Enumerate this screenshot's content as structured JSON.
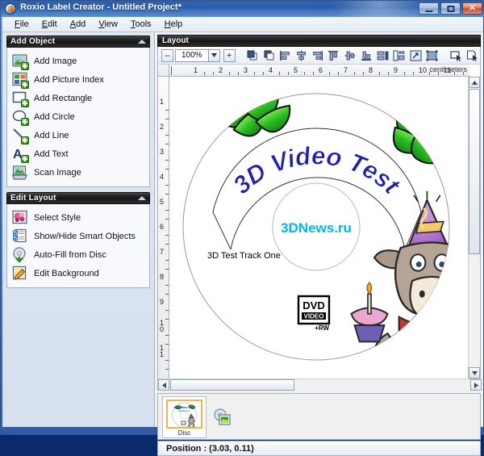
{
  "window": {
    "title": "Roxio Label Creator - Untitled Project*",
    "app_icon": "roxio-disc-icon",
    "minimize_label": "–",
    "maximize_label": "",
    "close_label": "✕"
  },
  "menubar": {
    "items": [
      {
        "name": "file",
        "label": "File",
        "mnemonic": "F"
      },
      {
        "name": "edit",
        "label": "Edit",
        "mnemonic": "E"
      },
      {
        "name": "add",
        "label": "Add",
        "mnemonic": "A"
      },
      {
        "name": "view",
        "label": "View",
        "mnemonic": "V"
      },
      {
        "name": "tools",
        "label": "Tools",
        "mnemonic": "T"
      },
      {
        "name": "help",
        "label": "Help",
        "mnemonic": "H"
      }
    ]
  },
  "left_panel": {
    "groups": [
      {
        "title": "Add Object",
        "collapse_icon": "chevron-up-icon",
        "items": [
          {
            "label": "Add Image",
            "icon": "image-add-icon"
          },
          {
            "label": "Add Picture Index",
            "icon": "picture-index-add-icon"
          },
          {
            "label": "Add Rectangle",
            "icon": "rectangle-add-icon"
          },
          {
            "label": "Add Circle",
            "icon": "circle-add-icon"
          },
          {
            "label": "Add Line",
            "icon": "line-add-icon"
          },
          {
            "label": "Add Text",
            "icon": "text-add-icon"
          },
          {
            "label": "Scan Image",
            "icon": "scanner-icon"
          }
        ]
      },
      {
        "title": "Edit Layout",
        "collapse_icon": "chevron-up-icon",
        "items": [
          {
            "label": "Select Style",
            "icon": "style-palette-icon"
          },
          {
            "label": "Show/Hide Smart Objects",
            "icon": "smart-objects-icon"
          },
          {
            "label": "Auto-Fill from Disc",
            "icon": "autofill-disc-icon"
          },
          {
            "label": "Edit Background",
            "icon": "edit-background-icon"
          }
        ]
      }
    ]
  },
  "layout_pane": {
    "header_title": "Layout",
    "toolbar": {
      "zoom_out_label": "–",
      "zoom_value": "100%",
      "zoom_dropdown_icon": "chevron-down-icon",
      "zoom_in_label": "+",
      "buttons": [
        {
          "name": "bring-to-front",
          "tooltip": "Bring to Front",
          "icon": "bring-to-front-icon"
        },
        {
          "name": "send-to-back",
          "tooltip": "Send to Back",
          "icon": "send-to-back-icon"
        },
        {
          "name": "align-left",
          "tooltip": "Align Left",
          "icon": "align-left-icon"
        },
        {
          "name": "align-center-horizontal",
          "tooltip": "Align Center",
          "icon": "align-center-icon"
        },
        {
          "name": "align-right",
          "tooltip": "Align Right",
          "icon": "align-right-icon"
        },
        {
          "name": "align-top",
          "tooltip": "Align Top",
          "icon": "align-top-icon"
        },
        {
          "name": "align-middle",
          "tooltip": "Align Middle",
          "icon": "align-middle-icon"
        },
        {
          "name": "align-bottom",
          "tooltip": "Align Bottom",
          "icon": "align-bottom-icon"
        },
        {
          "name": "distribute-horizontal",
          "tooltip": "Distribute Horizontally",
          "icon": "distribute-horizontal-icon"
        },
        {
          "name": "distribute-vertical",
          "tooltip": "Distribute Vertically",
          "icon": "distribute-vertical-icon"
        },
        {
          "name": "resize-object",
          "tooltip": "Resize",
          "icon": "resize-icon"
        },
        {
          "name": "group-objects",
          "tooltip": "Group",
          "icon": "group-objects-icon"
        },
        {
          "name": "select-object",
          "tooltip": "Select Object",
          "icon": "select-object-icon"
        },
        {
          "name": "select-page",
          "tooltip": "Select Page",
          "icon": "select-page-icon"
        }
      ]
    },
    "ruler": {
      "unit_label": "centimeters",
      "h_ticks": [
        "1",
        "2",
        "3",
        "4",
        "5",
        "6",
        "7",
        "8",
        "9",
        "10",
        "11"
      ],
      "v_ticks": [
        "1",
        "2",
        "3",
        "4",
        "5",
        "6",
        "7",
        "8",
        "9",
        "10",
        "11"
      ]
    },
    "scrollbars": {
      "up_arrow": "▲",
      "down_arrow": "▼",
      "left_arrow": "◀",
      "right_arrow": "▶"
    }
  },
  "disc_label": {
    "title_text": "3D Video Test",
    "title_color": "#2020b0",
    "subtitle_text": "3DNews.ru",
    "subtitle_color": "#00b8e0",
    "track_text": "3D Test Track One",
    "track_color": "#000000",
    "logo": {
      "line1": "DVD",
      "line2": "VIDEO",
      "line3": "+RW"
    },
    "artwork": "party-cow-with-cupcake",
    "border_art": "green-leaf-garland"
  },
  "thumbnails": {
    "items": [
      {
        "caption": "Disc",
        "selected": true
      }
    ],
    "add_button_icon": "add-page-icon"
  },
  "statusbar": {
    "text": "Position : (3.03, 0.11)"
  },
  "colors": {
    "titlebar": "#2b5fa9",
    "panel_header": "#161616",
    "accent_orange": "#f0b44d",
    "frame_blue": "#4a79c4"
  }
}
